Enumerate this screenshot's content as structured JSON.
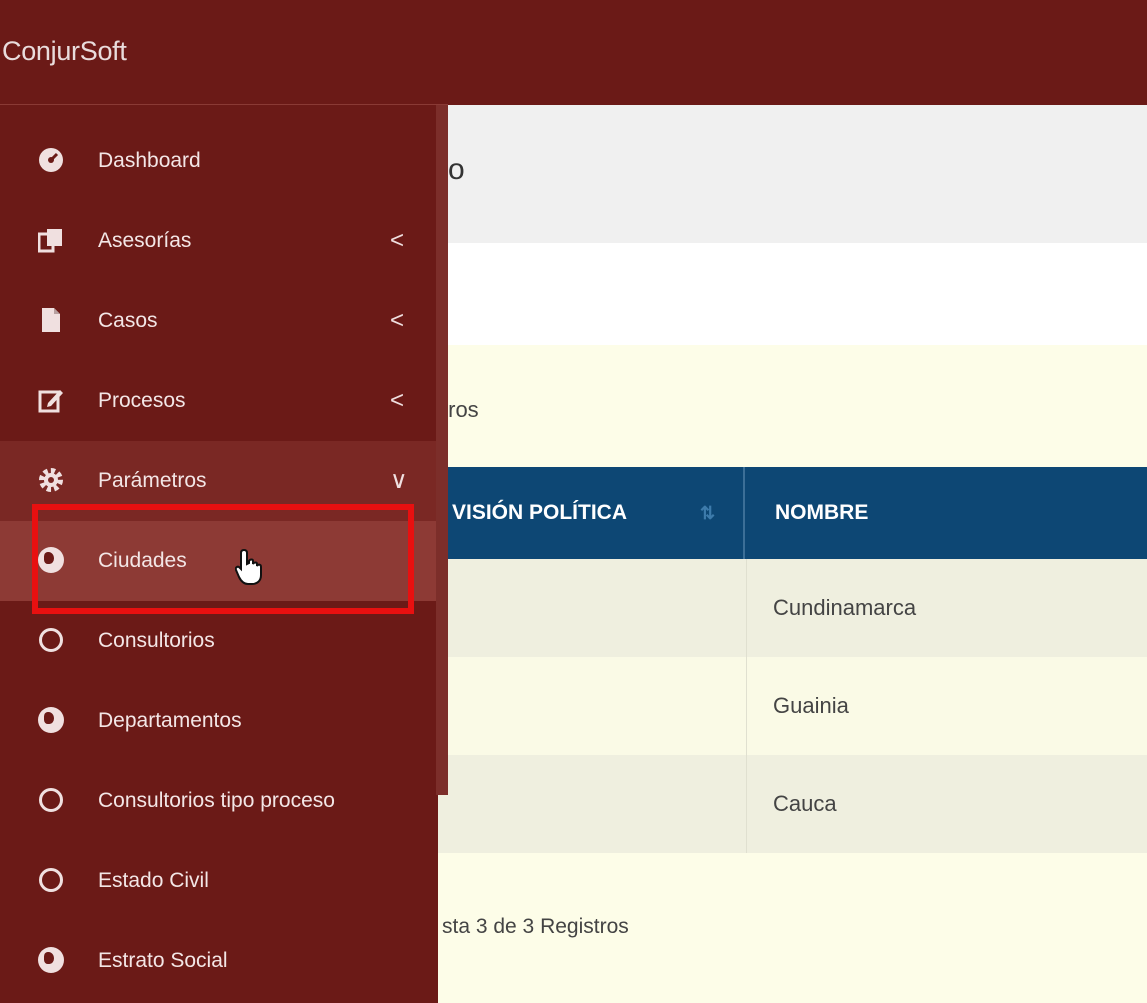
{
  "app": {
    "brand": "ConjurSoft"
  },
  "sidebar": {
    "items": [
      {
        "label": "Dashboard",
        "icon": "dashboard-icon",
        "chevron": ""
      },
      {
        "label": "Asesorías",
        "icon": "copy-icon",
        "chevron": "<"
      },
      {
        "label": "Casos",
        "icon": "file-icon",
        "chevron": "<"
      },
      {
        "label": "Procesos",
        "icon": "edit-icon",
        "chevron": "<"
      },
      {
        "label": "Parámetros",
        "icon": "gear-icon",
        "chevron": "∨"
      },
      {
        "label": "Ciudades",
        "icon": "globe-icon",
        "chevron": ""
      },
      {
        "label": "Consultorios",
        "icon": "circle-icon",
        "chevron": ""
      },
      {
        "label": "Departamentos",
        "icon": "globe-icon",
        "chevron": ""
      },
      {
        "label": "Consultorios tipo proceso",
        "icon": "circle-icon",
        "chevron": ""
      },
      {
        "label": "Estado Civil",
        "icon": "circle-icon",
        "chevron": ""
      },
      {
        "label": "Estrato Social",
        "icon": "globe-icon",
        "chevron": ""
      }
    ]
  },
  "main": {
    "title_fragment": "o",
    "card_header_fragment": "tros",
    "table": {
      "headers": [
        "VISIÓN POLÍTICA",
        "NOMBRE"
      ],
      "rows": [
        {
          "nombre": "Cundinamarca"
        },
        {
          "nombre": "Guainia"
        },
        {
          "nombre": "Cauca"
        }
      ]
    },
    "footer_fragment": "sta 3 de 3 Registros"
  },
  "colors": {
    "sidebar": "#6b1a17",
    "table_header": "#0d4774",
    "highlight_box": "#e81010"
  }
}
